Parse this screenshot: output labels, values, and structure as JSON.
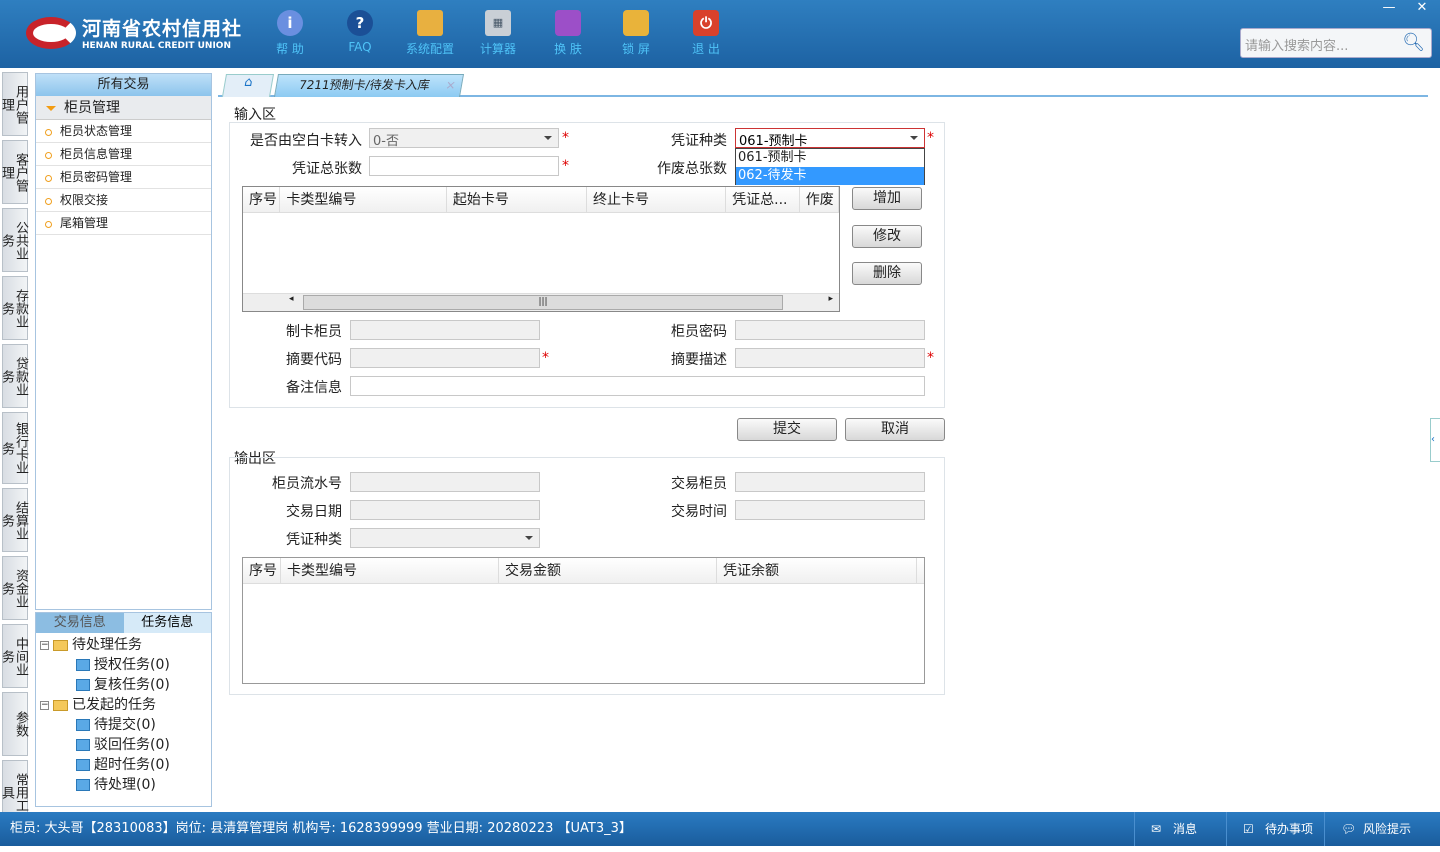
{
  "header": {
    "logo_cn": "河南省农村信用社",
    "logo_en": "HENAN RURAL CREDIT UNION",
    "tools": [
      {
        "label": "帮 助",
        "icon": "info-icon"
      },
      {
        "label": "FAQ",
        "icon": "question-icon"
      },
      {
        "label": "系统配置",
        "icon": "toolbox-icon"
      },
      {
        "label": "计算器",
        "icon": "calculator-icon"
      },
      {
        "label": "换 肤",
        "icon": "shirt-icon"
      },
      {
        "label": "锁 屏",
        "icon": "lock-icon"
      },
      {
        "label": "退 出",
        "icon": "power-icon"
      }
    ],
    "search_placeholder": "请输入搜索内容..."
  },
  "vtabs": [
    "用户管理",
    "客户管理",
    "公共业务",
    "存款业务",
    "贷款业务",
    "银行卡业务",
    "结算业务",
    "资金业务",
    "中间业务",
    "参数",
    "常用工具"
  ],
  "sidebar": {
    "title": "所有交易",
    "group": "柜员管理",
    "items": [
      "柜员状态管理",
      "柜员信息管理",
      "柜员密码管理",
      "权限交接",
      "尾箱管理"
    ]
  },
  "taskpanel": {
    "tabs": [
      "交易信息",
      "任务信息"
    ],
    "pending": "待处理任务",
    "pending_items": [
      "授权任务(0)",
      "复核任务(0)"
    ],
    "started": "已发起的任务",
    "started_items": [
      "待提交(0)",
      "驳回任务(0)",
      "超时任务(0)",
      "待处理(0)"
    ]
  },
  "tabs": {
    "active": "7211预制卡/待发卡入库"
  },
  "input": {
    "title": "输入区",
    "blank_label": "是否由空白卡转入",
    "blank_value": "0-否",
    "vtype_label": "凭证种类",
    "vtype_value": "061-预制卡",
    "vtype_options": [
      "061-预制卡",
      "062-待发卡"
    ],
    "total_label": "凭证总张数",
    "void_label": "作废总张数",
    "columns": [
      "序号",
      "卡类型编号",
      "起始卡号",
      "终止卡号",
      "凭证总...",
      "作废"
    ],
    "buttons": {
      "add": "增加",
      "edit": "修改",
      "delete": "删除"
    },
    "maker_label": "制卡柜员",
    "pwd_label": "柜员密码",
    "code_label": "摘要代码",
    "desc_label": "摘要描述",
    "note_label": "备注信息"
  },
  "actions": {
    "submit": "提交",
    "cancel": "取消"
  },
  "output": {
    "title": "输出区",
    "serial_label": "柜员流水号",
    "teller_label": "交易柜员",
    "date_label": "交易日期",
    "time_label": "交易时间",
    "vtype_label": "凭证种类",
    "columns": [
      "序号",
      "卡类型编号",
      "交易金额",
      "凭证余额"
    ]
  },
  "status": {
    "text": "柜员: 大头哥【28310083】岗位: 县清算管理岗  机构号: 1628399999  营业日期: 20280223 【UAT3_3】",
    "msg": "消息",
    "todo": "待办事项",
    "risk": "风险提示"
  }
}
